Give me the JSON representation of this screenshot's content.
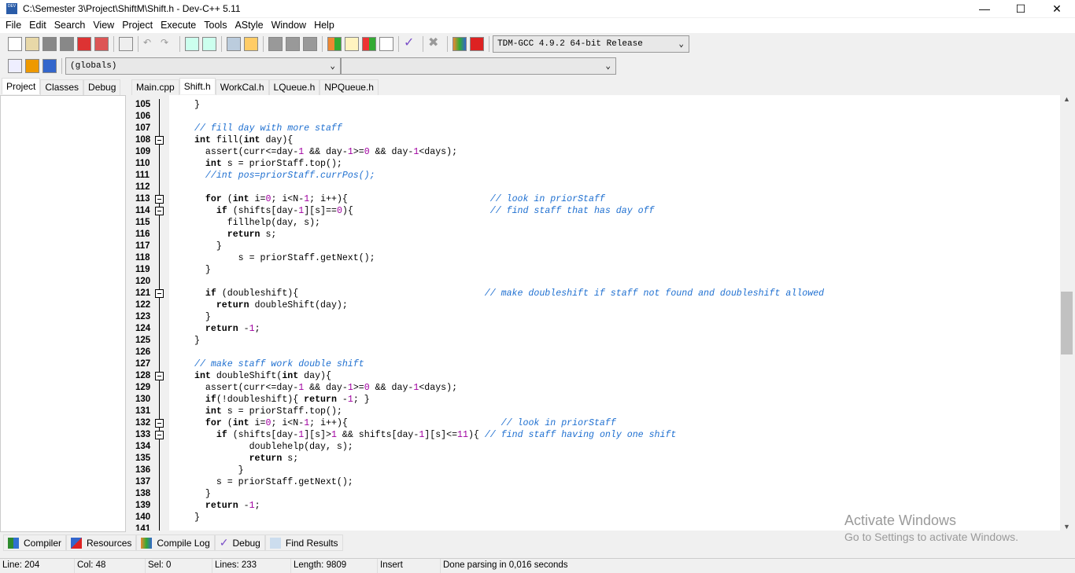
{
  "window": {
    "title": "C:\\Semester 3\\Project\\ShiftM\\Shift.h - Dev-C++ 5.11",
    "minimize": "—",
    "maximize": "☐",
    "close": "✕"
  },
  "menu": [
    "File",
    "Edit",
    "Search",
    "View",
    "Project",
    "Execute",
    "Tools",
    "AStyle",
    "Window",
    "Help"
  ],
  "toolbar": {
    "compiler_select": "TDM-GCC 4.9.2 64-bit Release",
    "scope_select": "(globals)",
    "member_select": ""
  },
  "left_tabs": [
    "Project",
    "Classes",
    "Debug"
  ],
  "file_tabs": [
    "Main.cpp",
    "Shift.h",
    "WorkCal.h",
    "LQueue.h",
    "NPQueue.h"
  ],
  "active_file_tab": "Shift.h",
  "code_lines": [
    {
      "n": "105",
      "t": "}"
    },
    {
      "n": "106",
      "t": ""
    },
    {
      "n": "107",
      "t": "// fill day with more staff"
    },
    {
      "n": "108",
      "t": "int fill(int day){",
      "f": 1
    },
    {
      "n": "109",
      "t": "  assert(curr<=day-1 && day-1>=0 && day-1<days);"
    },
    {
      "n": "110",
      "t": "  int s = priorStaff.top();"
    },
    {
      "n": "111",
      "t": "  //int pos=priorStaff.currPos();"
    },
    {
      "n": "112",
      "t": ""
    },
    {
      "n": "113",
      "t": "  for (int i=0; i<N-1; i++){                          // look in priorStaff",
      "f": 1
    },
    {
      "n": "114",
      "t": "    if (shifts[day-1][s]==0){                         // find staff that has day off",
      "f": 1
    },
    {
      "n": "115",
      "t": "      fillhelp(day, s);"
    },
    {
      "n": "116",
      "t": "      return s;"
    },
    {
      "n": "117",
      "t": "    }"
    },
    {
      "n": "118",
      "t": "        s = priorStaff.getNext();"
    },
    {
      "n": "119",
      "t": "  }"
    },
    {
      "n": "120",
      "t": ""
    },
    {
      "n": "121",
      "t": "  if (doubleshift){                                  // make doubleshift if staff not found and doubleshift allowed",
      "f": 1
    },
    {
      "n": "122",
      "t": "    return doubleShift(day);"
    },
    {
      "n": "123",
      "t": "  }"
    },
    {
      "n": "124",
      "t": "  return -1;"
    },
    {
      "n": "125",
      "t": "}"
    },
    {
      "n": "126",
      "t": ""
    },
    {
      "n": "127",
      "t": "// make staff work double shift"
    },
    {
      "n": "128",
      "t": "int doubleShift(int day){",
      "f": 1
    },
    {
      "n": "129",
      "t": "  assert(curr<=day-1 && day-1>=0 && day-1<days);"
    },
    {
      "n": "130",
      "t": "  if(!doubleshift){ return -1; }"
    },
    {
      "n": "131",
      "t": "  int s = priorStaff.top();"
    },
    {
      "n": "132",
      "t": "  for (int i=0; i<N-1; i++){                            // look in priorStaff",
      "f": 1
    },
    {
      "n": "133",
      "t": "    if (shifts[day-1][s]>1 && shifts[day-1][s]<=11){ // find staff having only one shift",
      "f": 1
    },
    {
      "n": "134",
      "t": "          doublehelp(day, s);"
    },
    {
      "n": "135",
      "t": "          return s;"
    },
    {
      "n": "136",
      "t": "        }"
    },
    {
      "n": "137",
      "t": "    s = priorStaff.getNext();"
    },
    {
      "n": "138",
      "t": "  }"
    },
    {
      "n": "139",
      "t": "  return -1;"
    },
    {
      "n": "140",
      "t": "}"
    },
    {
      "n": "141",
      "t": ""
    }
  ],
  "bottom_tabs": [
    "Compiler",
    "Resources",
    "Compile Log",
    "Debug",
    "Find Results"
  ],
  "status": {
    "line": "Line:   204",
    "col": "Col:    48",
    "sel": "Sel:     0",
    "lines": "Lines:    233",
    "length": "Length:  9809",
    "mode": "Insert",
    "message": "Done parsing in 0,016 seconds"
  },
  "watermark": {
    "line1": "Activate Windows",
    "line2": "Go to Settings to activate Windows."
  },
  "colors": {
    "comment": "#1e6fd0",
    "number": "#a000a0",
    "keyword": "#000000"
  }
}
